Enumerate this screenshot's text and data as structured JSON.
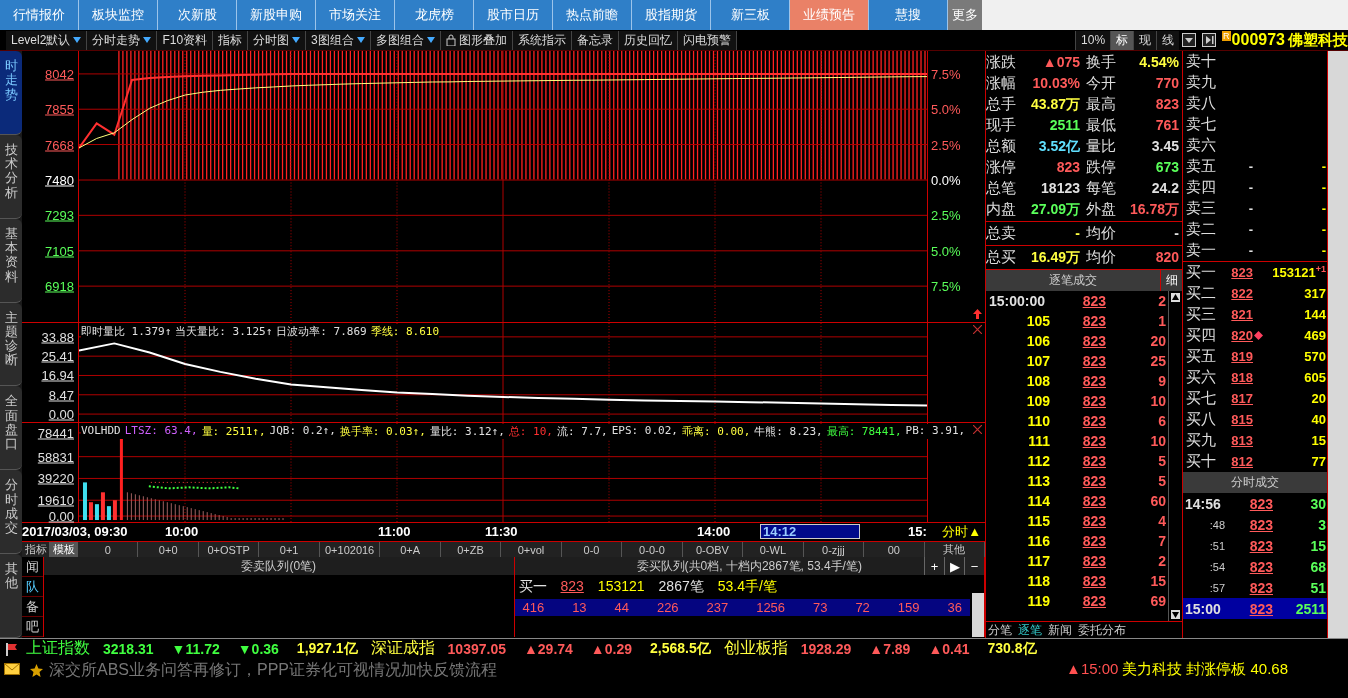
{
  "nav": [
    {
      "label": "行情报价",
      "selected": false
    },
    {
      "label": "板块监控",
      "selected": false
    },
    {
      "label": "次新股",
      "selected": false
    },
    {
      "label": "新股申购",
      "selected": false
    },
    {
      "label": "市场关注",
      "selected": false
    },
    {
      "label": "龙虎榜",
      "selected": false
    },
    {
      "label": "股市日历",
      "selected": false
    },
    {
      "label": "热点前瞻",
      "selected": false
    },
    {
      "label": "股指期货",
      "selected": false
    },
    {
      "label": "新三板",
      "selected": false
    },
    {
      "label": "业绩预告",
      "selected": true
    },
    {
      "label": "慧搜",
      "selected": false
    }
  ],
  "nav_more": "更多",
  "toolbar": {
    "buttons": [
      {
        "label": "Level2默认",
        "dropdown": true
      },
      {
        "label": "分时走势",
        "dropdown": true
      },
      {
        "label": "F10资料",
        "dropdown": false
      },
      {
        "label": "指标",
        "dropdown": false
      },
      {
        "label": "分时图",
        "dropdown": true
      },
      {
        "label": "3图组合",
        "dropdown": true
      },
      {
        "label": "多图组合",
        "dropdown": true
      },
      {
        "label": "图形叠加",
        "dropdown": false
      },
      {
        "label": "系统指示",
        "dropdown": false
      },
      {
        "label": "备忘录",
        "dropdown": false
      },
      {
        "label": "历史回忆",
        "dropdown": false
      },
      {
        "label": "闪电预警",
        "dropdown": false
      }
    ],
    "views": [
      {
        "label": "10%",
        "selected": false
      },
      {
        "label": "标",
        "selected": true
      },
      {
        "label": "现",
        "selected": false
      },
      {
        "label": "线",
        "selected": false
      }
    ],
    "badge": "R",
    "code": "000973",
    "name": "佛塑科技"
  },
  "side_tabs": [
    {
      "label": "时走势",
      "selected": true
    },
    {
      "label": "技术分析",
      "selected": false
    },
    {
      "label": "基本资料",
      "selected": false
    },
    {
      "label": "主题诊断",
      "selected": false
    },
    {
      "label": "全面盘口",
      "selected": false
    },
    {
      "label": "分时成交",
      "selected": false
    },
    {
      "label": "其他",
      "selected": false
    }
  ],
  "price_chart": {
    "right_ticks": [
      {
        "label": "7.5%",
        "color": "#ff5a5a"
      },
      {
        "label": "5.0%",
        "color": "#ff5a5a"
      },
      {
        "label": "2.5%",
        "color": "#ff5a5a"
      },
      {
        "label": "0.0%",
        "color": "#ffffff"
      },
      {
        "label": "2.5%",
        "color": "#5aff5a"
      },
      {
        "label": "5.0%",
        "color": "#5aff5a"
      },
      {
        "label": "7.5%",
        "color": "#5aff5a"
      }
    ],
    "chart_data": {
      "type": "line",
      "grid": true,
      "categories": [
        null,
        null,
        null,
        null,
        null,
        null,
        null,
        null,
        null,
        null,
        null,
        null,
        null,
        null,
        null,
        null,
        null,
        null,
        null,
        null,
        null,
        null,
        null,
        null,
        null,
        null,
        null,
        null,
        null,
        null,
        null,
        null,
        null,
        null,
        null,
        null,
        null,
        null,
        null,
        null,
        null,
        null,
        null,
        null,
        null,
        null,
        null,
        null,
        null
      ],
      "ylim": [
        6918,
        8042
      ],
      "yticks": [
        {
          "value": 8042,
          "label": "8042"
        },
        {
          "value": 7855,
          "label": "7855"
        },
        {
          "value": 7668,
          "label": "7668"
        },
        {
          "value": 7480,
          "label": "7480"
        },
        {
          "value": 7293,
          "label": "7293"
        },
        {
          "value": 7105,
          "label": "7105"
        },
        {
          "value": 6918,
          "label": "6918"
        }
      ],
      "series": [
        {
          "color": "#ff3030",
          "values": [
            7650,
            7780,
            7720,
            8010,
            8020,
            8025,
            8030,
            8032,
            8034,
            8036,
            8038,
            8040,
            8041,
            8042,
            8042,
            8042,
            8042,
            8042,
            8042,
            8042,
            8042,
            8042,
            8042,
            8042,
            8042,
            8042,
            8042,
            8042,
            8042,
            8042,
            8042,
            8042,
            8042,
            8042,
            8042,
            8042,
            8042,
            8042,
            8042,
            8042,
            8042,
            8042,
            8042,
            8042,
            8042,
            8042,
            8042,
            8042,
            8042
          ]
        },
        {
          "color": "#ffff80",
          "values": [
            7650,
            7700,
            7730,
            7800,
            7860,
            7900,
            7930,
            7945,
            7955,
            7962,
            7968,
            7973,
            7978,
            7982,
            7985,
            7988,
            7991,
            7993,
            7995,
            7997,
            7999,
            8000,
            8002,
            8003,
            8004,
            8005,
            8006,
            8007,
            8008,
            8009,
            8010,
            8011,
            8012,
            8013,
            8014,
            8015,
            8016,
            8017,
            8018,
            8019,
            8020,
            8021,
            8022,
            8023,
            8024,
            8025,
            8026,
            8027,
            8028
          ]
        }
      ]
    }
  },
  "ratio_panel": {
    "legend": [
      {
        "text": "即时量比 1.379↑",
        "color": "#e0e0e0"
      },
      {
        "text": "当天量比: 3.125↑",
        "color": "#e0e0e0"
      },
      {
        "text": "日波动率: 7.869",
        "color": "#e0e0e0"
      },
      {
        "text": "季线: 8.610",
        "color": "#ffff40"
      }
    ],
    "chart_data": {
      "type": "line",
      "grid": true,
      "categories": [
        null,
        null,
        null,
        null,
        null,
        null,
        null,
        null,
        null,
        null,
        null,
        null,
        null,
        null,
        null,
        null,
        null,
        null,
        null,
        null,
        null,
        null,
        null,
        null,
        null
      ],
      "ylim": [
        0,
        33.88
      ],
      "yticks": [
        {
          "value": 33.88,
          "label": "33.88"
        },
        {
          "value": 25.41,
          "label": "25.41"
        },
        {
          "value": 16.94,
          "label": "16.94"
        },
        {
          "value": 8.47,
          "label": "8.47"
        },
        {
          "value": 0,
          "label": "0.00"
        }
      ],
      "series": [
        {
          "color": "#ffffff",
          "values": [
            27.9,
            31,
            27,
            22,
            18.5,
            15.5,
            13,
            11.8,
            10.6,
            9.5,
            8.8,
            8.1,
            7.5,
            7.1,
            6.7,
            6.3,
            6,
            5.7,
            5.5,
            5.2,
            5,
            4.6,
            4.3,
            4,
            3.8
          ]
        }
      ]
    }
  },
  "volume_panel": {
    "legend": [
      {
        "text": "VOLHDD",
        "color": "#e0e0e0"
      },
      {
        "text": "LTSZ: 63.4,",
        "color": "#d060ff"
      },
      {
        "text": "量: 2511↑,",
        "color": "#ffff40"
      },
      {
        "text": "JQB: 0.2↑,",
        "color": "#e0e0e0"
      },
      {
        "text": "换手率: 0.03↑,",
        "color": "#ffff40"
      },
      {
        "text": "量比: 3.12↑,",
        "color": "#e0e0e0"
      },
      {
        "text": "总: 10,",
        "color": "#ff3030"
      },
      {
        "text": "流: 7.7,",
        "color": "#e0e0e0"
      },
      {
        "text": "EPS: 0.02,",
        "color": "#e0e0e0"
      },
      {
        "text": "乖离: 0.00,",
        "color": "#ffff40"
      },
      {
        "text": "牛熊: 8.23,",
        "color": "#e0e0e0"
      },
      {
        "text": "最高: 78441,",
        "color": "#40ff40"
      },
      {
        "text": "PB: 3.91,",
        "color": "#e0e0e0"
      }
    ],
    "ticks": [
      "78441",
      "58831",
      "39220",
      "19610",
      "0.00"
    ]
  },
  "time_axis": {
    "labels": [
      "2017/03/03, 09:30",
      "10:00",
      "11:00",
      "11:30",
      "14:00",
      "15:"
    ],
    "cursor": "14:12",
    "mode": "分时▲"
  },
  "indicator_tabs": [
    {
      "label": "指标",
      "selected": false
    },
    {
      "label": "模板",
      "selected": true
    },
    {
      "label": "0",
      "selected": false
    },
    {
      "label": "0+0",
      "selected": false
    },
    {
      "label": "0+OSTP",
      "selected": false
    },
    {
      "label": "0+1",
      "selected": false
    },
    {
      "label": "0+102016",
      "selected": false
    },
    {
      "label": "0+A",
      "selected": false
    },
    {
      "label": "0+ZB",
      "selected": false
    },
    {
      "label": "0+vol",
      "selected": false
    },
    {
      "label": "0-0",
      "selected": false
    },
    {
      "label": "0-0-0",
      "selected": false
    },
    {
      "label": "0-OBV",
      "selected": false
    },
    {
      "label": "0-WL",
      "selected": false
    },
    {
      "label": "0-zjjj",
      "selected": false
    },
    {
      "label": "00",
      "selected": false
    },
    {
      "label": "其他",
      "selected": false
    }
  ],
  "queue_tabs": [
    {
      "label": "闻",
      "selected": false
    },
    {
      "label": "队",
      "selected": true
    },
    {
      "label": "备",
      "selected": false
    },
    {
      "label": "吧",
      "selected": false
    }
  ],
  "sell_queue": {
    "title": "委卖队列(0笔)"
  },
  "buy_queue": {
    "title": "委买队列(共0档, 十档内2867笔, 53.4手/笔)",
    "buttons": [
      "+",
      "▶",
      "−"
    ],
    "summary": {
      "label": "买一",
      "price": "823",
      "volume": "153121",
      "orders": "2867笔",
      "avg": "53.4手/笔"
    },
    "orders": [
      "416",
      "13",
      "44",
      "226",
      "237",
      "1256",
      "73",
      "72",
      "159",
      "36"
    ]
  },
  "quote": [
    [
      {
        "label": "涨跌",
        "value": "▲075",
        "color": "#ff5a5a"
      },
      {
        "label": "换手",
        "value": "4.54%",
        "color": "#ffff40"
      }
    ],
    [
      {
        "label": "涨幅",
        "value": "10.03%",
        "color": "#ff5a5a"
      },
      {
        "label": "今开",
        "value": "770",
        "color": "#ff5a5a"
      }
    ],
    [
      {
        "label": "总手",
        "value": "43.87万",
        "color": "#ffff40"
      },
      {
        "label": "最高",
        "value": "823",
        "color": "#ff5a5a"
      }
    ],
    [
      {
        "label": "现手",
        "value": "2511",
        "color": "#5aff5a"
      },
      {
        "label": "最低",
        "value": "761",
        "color": "#ff5a5a"
      }
    ],
    [
      {
        "label": "总额",
        "value": "3.52亿",
        "color": "#60e0ff"
      },
      {
        "label": "量比",
        "value": "3.45",
        "color": "#e0e0e0"
      }
    ],
    [
      {
        "label": "涨停",
        "value": "823",
        "color": "#ff5a5a"
      },
      {
        "label": "跌停",
        "value": "673",
        "color": "#5aff5a"
      }
    ],
    [
      {
        "label": "总笔",
        "value": "18123",
        "color": "#e0e0e0"
      },
      {
        "label": "每笔",
        "value": "24.2",
        "color": "#e0e0e0"
      }
    ],
    [
      {
        "label": "内盘",
        "value": "27.09万",
        "color": "#5aff5a"
      },
      {
        "label": "外盘",
        "value": "16.78万",
        "color": "#ff5a5a"
      }
    ]
  ],
  "totals": [
    [
      {
        "label": "总卖",
        "value": "-",
        "color": "#ffff40"
      },
      {
        "label": "均价",
        "value": "-",
        "color": "#e0e0e0"
      }
    ],
    [
      {
        "label": "总买",
        "value": "16.49万",
        "color": "#ffff40"
      },
      {
        "label": "均价",
        "value": "820",
        "color": "#ff5a5a"
      }
    ]
  ],
  "ticks_header": {
    "title": "逐笔成交",
    "detail": "细"
  },
  "ticks": [
    {
      "kind": "time",
      "time": "15:00:00",
      "price": "823",
      "volume": "2"
    },
    {
      "kind": "seq",
      "time": "105",
      "price": "823",
      "volume": "1"
    },
    {
      "kind": "seq",
      "time": "106",
      "price": "823",
      "volume": "20"
    },
    {
      "kind": "seq",
      "time": "107",
      "price": "823",
      "volume": "25"
    },
    {
      "kind": "seq",
      "time": "108",
      "price": "823",
      "volume": "9"
    },
    {
      "kind": "seq",
      "time": "109",
      "price": "823",
      "volume": "10"
    },
    {
      "kind": "seq",
      "time": "110",
      "price": "823",
      "volume": "6"
    },
    {
      "kind": "seq",
      "time": "111",
      "price": "823",
      "volume": "10"
    },
    {
      "kind": "seq",
      "time": "112",
      "price": "823",
      "volume": "5"
    },
    {
      "kind": "seq",
      "time": "113",
      "price": "823",
      "volume": "5"
    },
    {
      "kind": "seq",
      "time": "114",
      "price": "823",
      "volume": "60"
    },
    {
      "kind": "seq",
      "time": "115",
      "price": "823",
      "volume": "4"
    },
    {
      "kind": "seq",
      "time": "116",
      "price": "823",
      "volume": "7"
    },
    {
      "kind": "seq",
      "time": "117",
      "price": "823",
      "volume": "2"
    },
    {
      "kind": "seq",
      "time": "118",
      "price": "823",
      "volume": "15"
    },
    {
      "kind": "seq",
      "time": "119",
      "price": "823",
      "volume": "69"
    }
  ],
  "asks": [
    {
      "label": "卖十"
    },
    {
      "label": "卖九"
    },
    {
      "label": "卖八"
    },
    {
      "label": "卖七"
    },
    {
      "label": "卖六"
    },
    {
      "label": "卖五",
      "price": "-",
      "volume": "-"
    },
    {
      "label": "卖四",
      "price": "-",
      "volume": "-"
    },
    {
      "label": "卖三",
      "price": "-",
      "volume": "-"
    },
    {
      "label": "卖二",
      "price": "-",
      "volume": "-"
    },
    {
      "label": "卖一",
      "price": "-",
      "volume": "-"
    }
  ],
  "bids": [
    {
      "label": "买一",
      "price": "823",
      "volume": "153121",
      "change": "+1",
      "marker": false
    },
    {
      "label": "买二",
      "price": "822",
      "volume": "317",
      "marker": false
    },
    {
      "label": "买三",
      "price": "821",
      "volume": "144",
      "marker": false
    },
    {
      "label": "买四",
      "price": "820",
      "volume": "469",
      "marker": true
    },
    {
      "label": "买五",
      "price": "819",
      "volume": "570",
      "marker": false
    },
    {
      "label": "买六",
      "price": "818",
      "volume": "605",
      "marker": false
    },
    {
      "label": "买七",
      "price": "817",
      "volume": "20",
      "marker": false
    },
    {
      "label": "买八",
      "price": "815",
      "volume": "40",
      "marker": false
    },
    {
      "label": "买九",
      "price": "813",
      "volume": "15",
      "marker": false
    },
    {
      "label": "买十",
      "price": "812",
      "volume": "77",
      "marker": false
    }
  ],
  "minute_header": "分时成交",
  "minute_trades": [
    {
      "kind": "full",
      "time": "14:56",
      "price": "823",
      "volume": "30",
      "selected": false
    },
    {
      "kind": "short",
      "time": ":48",
      "price": "823",
      "volume": "3",
      "selected": false
    },
    {
      "kind": "short",
      "time": ":51",
      "price": "823",
      "volume": "15",
      "selected": false
    },
    {
      "kind": "short",
      "time": ":54",
      "price": "823",
      "volume": "68",
      "selected": false
    },
    {
      "kind": "short",
      "time": ":57",
      "price": "823",
      "volume": "51",
      "selected": false
    },
    {
      "kind": "full",
      "time": "15:00",
      "price": "823",
      "volume": "2511",
      "selected": true
    }
  ],
  "bottom_tabs": [
    {
      "label": "分笔",
      "selected": false
    },
    {
      "label": "逐笔",
      "selected": true
    },
    {
      "label": "新闻",
      "selected": false
    },
    {
      "label": "委托分布",
      "selected": false
    }
  ],
  "indexes": [
    {
      "text": "上证指数",
      "color": "#40ff40",
      "kind": "name"
    },
    {
      "text": "3218.31",
      "color": "#40ff40"
    },
    {
      "text": "▼11.72",
      "color": "#40ff40"
    },
    {
      "text": "▼0.36",
      "color": "#40ff40"
    },
    {
      "text": "1,927.1亿",
      "color": "#ffff40"
    },
    {
      "text": "深证成指",
      "color": "#ffff40",
      "kind": "name"
    },
    {
      "text": "10397.05",
      "color": "#ff5a5a"
    },
    {
      "text": "▲29.74",
      "color": "#ff5a5a"
    },
    {
      "text": "▲0.29",
      "color": "#ff5a5a"
    },
    {
      "text": "2,568.5亿",
      "color": "#ffff40"
    },
    {
      "text": "创业板指",
      "color": "#ffff40",
      "kind": "name"
    },
    {
      "text": "1928.29",
      "color": "#ff5a5a"
    },
    {
      "text": "▲7.89",
      "color": "#ff5a5a"
    },
    {
      "text": "▲0.41",
      "color": "#ff5a5a"
    },
    {
      "text": "730.8亿",
      "color": "#ffff40"
    }
  ],
  "news": {
    "headline": "深交所ABS业务问答再修订，PPP证券化可视情况加快反馈流程",
    "alert_time": "▲15:00",
    "alert_stock": "美力科技",
    "alert_event": "封涨停板",
    "alert_price": "40.68"
  }
}
